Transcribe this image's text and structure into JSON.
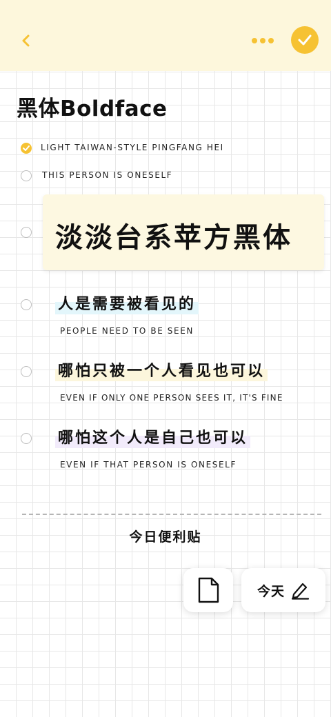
{
  "header": {
    "back_icon": "chevron-left-icon",
    "more_icon": "more-dots-icon",
    "done_icon": "check-icon",
    "accent_color": "#f6c233"
  },
  "title": "黑体Boldface",
  "items": [
    {
      "text": "LIGHT TAIWAN-STYLE PINGFANG HEI",
      "checked": true
    },
    {
      "text": "THIS PERSON IS ONESELF",
      "checked": false
    },
    {
      "text": "淡淡台系苹方黑体",
      "checked": false
    },
    {
      "text": "人是需要被看见的",
      "subtitle": "PEOPLE NEED TO BE SEEN",
      "checked": false
    },
    {
      "text": "哪怕只被一个人看见也可以",
      "subtitle": "EVEN IF ONLY ONE PERSON SEES IT, IT'S FINE",
      "checked": false
    },
    {
      "text": "哪怕这个人是自己也可以",
      "subtitle": "EVEN IF THAT PERSON IS ONESELF",
      "checked": false
    }
  ],
  "footer": {
    "label": "今日便利贴",
    "doc_icon": "document-icon",
    "today_label": "今天",
    "edit_icon": "pencil-icon"
  }
}
